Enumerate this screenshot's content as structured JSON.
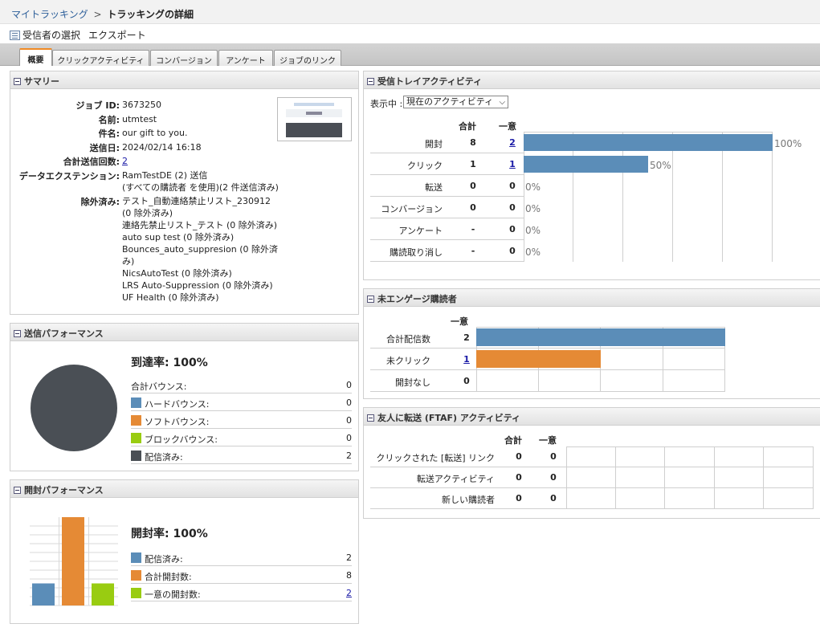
{
  "breadcrumb": {
    "parent": "マイトラッキング",
    "separator": ">",
    "current": "トラッキングの詳細"
  },
  "toolbar": {
    "select_recipients": "受信者の選択",
    "export": "エクスポート"
  },
  "tabs": [
    {
      "label": "概要",
      "active": true
    },
    {
      "label": "クリックアクティビティ",
      "active": false
    },
    {
      "label": "コンバージョン",
      "active": false
    },
    {
      "label": "アンケート",
      "active": false
    },
    {
      "label": "ジョブのリンク",
      "active": false
    }
  ],
  "summary": {
    "title": "サマリー",
    "fields": [
      {
        "label": "ジョブ ID:",
        "value": "3673250"
      },
      {
        "label": "名前:",
        "value": "utmtest"
      },
      {
        "label": "件名:",
        "value": "our gift to you."
      },
      {
        "label": "送信日:",
        "value": "2024/02/14 16:18"
      },
      {
        "label": "合計送信回数:",
        "value": "2"
      },
      {
        "label": "データエクステンション:",
        "value": "RamTestDE (2) 送信"
      },
      {
        "label": "",
        "value": "(すべての購読者 を使用)(2 件送信済み)"
      },
      {
        "label": "除外済み:",
        "value": "テスト_自動連絡禁止リスト_230912"
      },
      {
        "label": "",
        "value": "(0 除外済み)"
      },
      {
        "label": "",
        "value": "連絡先禁止リスト_テスト (0 除外済み)"
      },
      {
        "label": "",
        "value": "auto sup test (0 除外済み)"
      },
      {
        "label": "",
        "value": "Bounces_auto_suppresion (0 除外済"
      },
      {
        "label": "",
        "value": "み)"
      },
      {
        "label": "",
        "value": "NicsAutoTest (0 除外済み)"
      },
      {
        "label": "",
        "value": "LRS Auto-Suppression (0 除外済み)"
      },
      {
        "label": "",
        "value": "UF Health (0 除外済み)"
      }
    ]
  },
  "send_performance": {
    "title": "送信パフォーマンス",
    "rate": "到達率: 100%",
    "rows": [
      {
        "label": "合計バウンス:",
        "value": "0",
        "color": ""
      },
      {
        "label": "ハードバウンス:",
        "value": "0",
        "color": "#5b8db8"
      },
      {
        "label": "ソフトバウンス:",
        "value": "0",
        "color": "#e58a35"
      },
      {
        "label": "ブロックバウンス:",
        "value": "0",
        "color": "#99cc11"
      },
      {
        "label": "配信済み:",
        "value": "2",
        "color": "#4a4f55"
      }
    ],
    "pie_color": "#4a4f55"
  },
  "open_performance": {
    "title": "開封パフォーマンス",
    "rate": "開封率: 100%",
    "rows": [
      {
        "label": "配信済み:",
        "value": "2",
        "color": "#5b8db8",
        "link": false
      },
      {
        "label": "合計開封数:",
        "value": "8",
        "color": "#e58a35",
        "link": false
      },
      {
        "label": "一意の開封数:",
        "value": "2",
        "color": "#99cc11",
        "link": true
      }
    ]
  },
  "inbox_activity": {
    "title": "受信トレイアクティビティ",
    "display_label": "表示中 :",
    "display_value": "現在のアクティビティ",
    "col_total": "合計",
    "col_unique": "一意",
    "rows": [
      {
        "label": "開封",
        "total": "8",
        "unique": "2",
        "unique_link": true,
        "percent_label": "100%"
      },
      {
        "label": "クリック",
        "total": "1",
        "unique": "1",
        "unique_link": true,
        "percent_label": "50%"
      },
      {
        "label": "転送",
        "total": "0",
        "unique": "0",
        "unique_link": false,
        "percent_label": "0%"
      },
      {
        "label": "コンバージョン",
        "total": "0",
        "unique": "0",
        "unique_link": false,
        "percent_label": "0%"
      },
      {
        "label": "アンケート",
        "total": "-",
        "unique": "0",
        "unique_link": false,
        "percent_label": "0%"
      },
      {
        "label": "購読取り消し",
        "total": "-",
        "unique": "0",
        "unique_link": false,
        "percent_label": "0%"
      }
    ],
    "bar_color": "#5b8db8"
  },
  "unengaged": {
    "title": "未エンゲージ購読者",
    "col_unique": "一意",
    "rows": [
      {
        "label": "合計配信数",
        "value": "2",
        "link": false,
        "color": "#5b8db8"
      },
      {
        "label": "未クリック",
        "value": "1",
        "link": true,
        "color": "#e58a35"
      },
      {
        "label": "開封なし",
        "value": "0",
        "link": false,
        "color": ""
      }
    ]
  },
  "ftaf": {
    "title": "友人に転送 (FTAF) アクティビティ",
    "col_total": "合計",
    "col_unique": "一意",
    "rows": [
      {
        "label": "クリックされた [転送] リンク",
        "total": "0",
        "unique": "0"
      },
      {
        "label": "転送アクティビティ",
        "total": "0",
        "unique": "0"
      },
      {
        "label": "新しい購読者",
        "total": "0",
        "unique": "0"
      }
    ]
  },
  "chart_data": [
    {
      "type": "pie",
      "categories": [
        "ハードバウンス",
        "ソフトバウンス",
        "ブロックバウンス",
        "配信済み"
      ],
      "values": [
        0,
        0,
        0,
        2
      ]
    },
    {
      "type": "bar",
      "categories": [
        "配信済み",
        "合計開封数",
        "一意の開封数"
      ],
      "values": [
        2,
        8,
        2
      ]
    },
    {
      "type": "bar",
      "orientation": "horizontal",
      "categories": [
        "開封",
        "クリック",
        "転送",
        "コンバージョン",
        "アンケート",
        "購読取り消し"
      ],
      "values": [
        100,
        50,
        0,
        0,
        0,
        0
      ],
      "xlim": [
        0,
        100
      ]
    },
    {
      "type": "bar",
      "orientation": "horizontal",
      "categories": [
        "合計配信数",
        "未クリック",
        "開封なし"
      ],
      "values": [
        2,
        1,
        0
      ],
      "xlim": [
        0,
        2
      ]
    }
  ]
}
